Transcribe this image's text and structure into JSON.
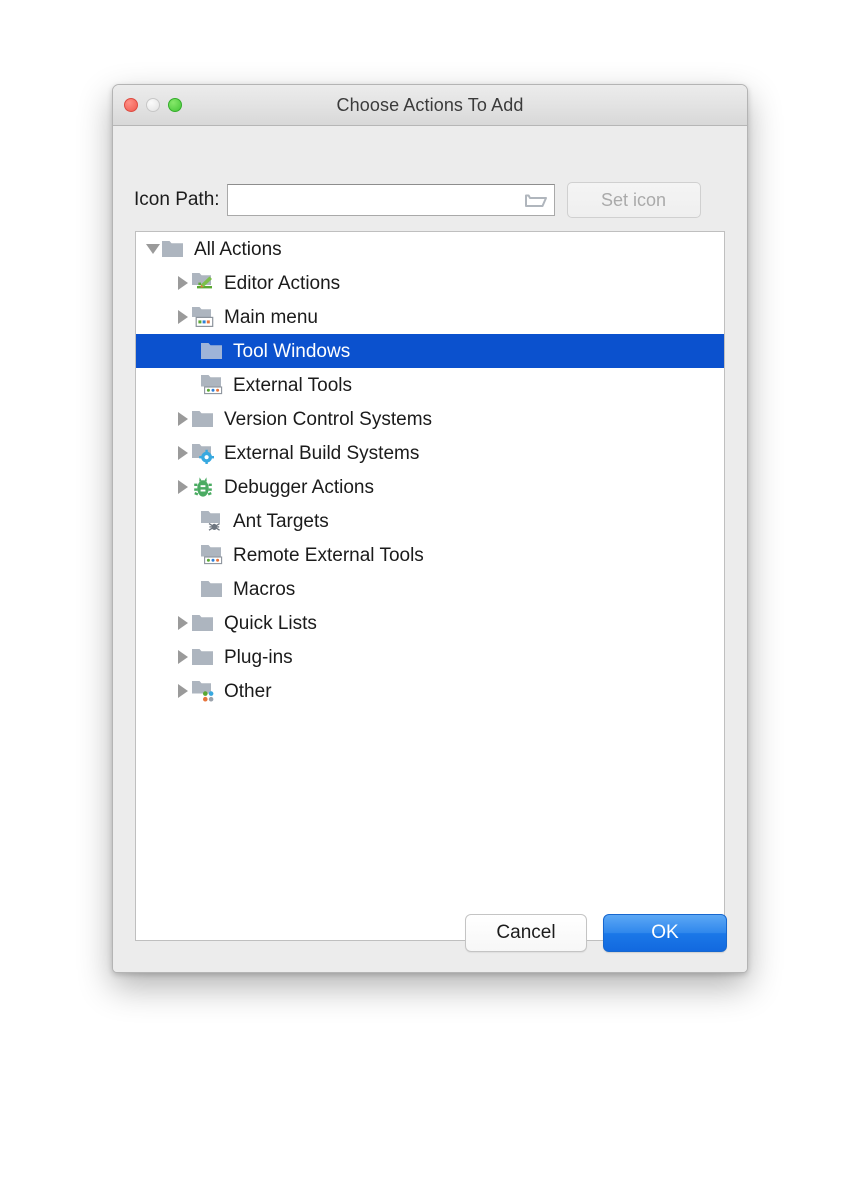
{
  "window": {
    "title": "Choose Actions To Add",
    "traffic_lights": [
      {
        "name": "close",
        "color": "#f05a4f"
      },
      {
        "name": "minimize",
        "color": "#e2e2e2"
      },
      {
        "name": "zoom",
        "color": "#45c637"
      }
    ]
  },
  "icon_path": {
    "label": "Icon Path:",
    "value": "",
    "placeholder": "",
    "browse_icon": "open-folder-icon",
    "set_icon_button": "Set icon",
    "set_icon_enabled": false
  },
  "tree": {
    "selection_color": "#0b51ce",
    "items": [
      {
        "label": "All Actions",
        "depth": 0,
        "twisty": "open",
        "icon": "folder-icon"
      },
      {
        "label": "Editor Actions",
        "depth": 1,
        "twisty": "closed",
        "icon": "folder-pencil-icon"
      },
      {
        "label": "Main menu",
        "depth": 1,
        "twisty": "closed",
        "icon": "folder-menu-icon"
      },
      {
        "label": "Tool Windows",
        "depth": 1,
        "twisty": "none",
        "icon": "folder-icon",
        "selected": true
      },
      {
        "label": "External Tools",
        "depth": 1,
        "twisty": "none",
        "icon": "folder-tools-icon"
      },
      {
        "label": "Version Control Systems",
        "depth": 1,
        "twisty": "closed",
        "icon": "folder-icon"
      },
      {
        "label": "External Build Systems",
        "depth": 1,
        "twisty": "closed",
        "icon": "folder-gear-icon"
      },
      {
        "label": "Debugger Actions",
        "depth": 1,
        "twisty": "closed",
        "icon": "bug-icon"
      },
      {
        "label": "Ant Targets",
        "depth": 1,
        "twisty": "none",
        "icon": "folder-ant-icon"
      },
      {
        "label": "Remote External Tools",
        "depth": 1,
        "twisty": "none",
        "icon": "folder-tools-icon"
      },
      {
        "label": "Macros",
        "depth": 1,
        "twisty": "none",
        "icon": "folder-icon"
      },
      {
        "label": "Quick Lists",
        "depth": 1,
        "twisty": "closed",
        "icon": "folder-icon"
      },
      {
        "label": "Plug-ins",
        "depth": 1,
        "twisty": "closed",
        "icon": "folder-icon"
      },
      {
        "label": "Other",
        "depth": 1,
        "twisty": "closed",
        "icon": "folder-dots-icon"
      }
    ]
  },
  "footer": {
    "cancel_label": "Cancel",
    "ok_label": "OK",
    "ok_accent": "#1b78e8"
  }
}
